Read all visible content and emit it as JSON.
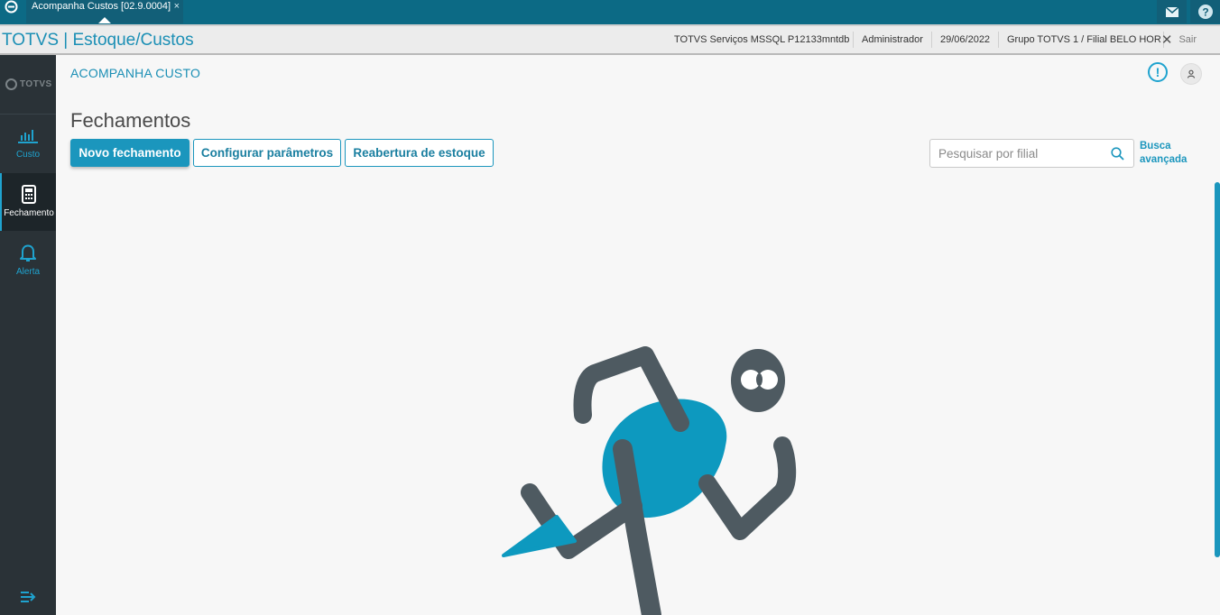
{
  "topbar": {
    "tab_title": "Acompanha Custos [02.9.0004]",
    "tab_close": "×"
  },
  "header": {
    "app_title": "TOTVS | Estoque/Custos",
    "server": "TOTVS Serviços MSSQL P12133mntdb",
    "user": "Administrador",
    "date": "29/06/2022",
    "branch": "Grupo TOTVS 1 / Filial BELO HOR",
    "exit_label": "Sair"
  },
  "sidebar": {
    "brand": "TOTVS",
    "items": [
      {
        "label": "Custo",
        "icon": "bar-chart-icon",
        "active": false
      },
      {
        "label": "Fechamento",
        "icon": "calculator-icon",
        "active": true
      },
      {
        "label": "Alerta",
        "icon": "bell-icon",
        "active": false
      }
    ]
  },
  "main": {
    "page_header": "ACOMPANHA CUSTO",
    "page_title": "Fechamentos",
    "buttons": {
      "new_closing": "Novo fechamento",
      "configure": "Configurar parâmetros",
      "reopen": "Reabertura de estoque"
    },
    "search": {
      "placeholder": "Pesquisar por filial",
      "value": ""
    },
    "advanced_search_line1": "Busca",
    "advanced_search_line2": "avançada"
  },
  "colors": {
    "topbar": "#0c6a85",
    "accent": "#1b96bd",
    "sidebar": "#2a3237",
    "figure_dark": "#4e5a61",
    "figure_blue": "#0d99bf"
  }
}
